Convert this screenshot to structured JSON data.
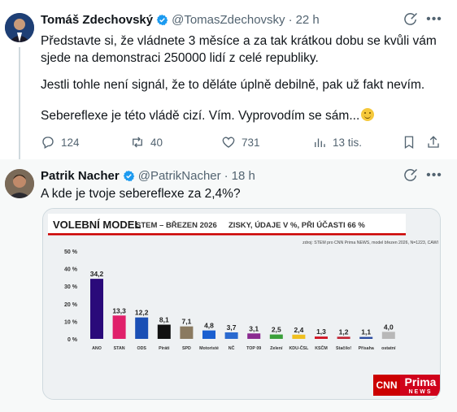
{
  "tweet1": {
    "author": "Tomáš Zdechovský",
    "handle": "@TomasZdechovsky",
    "separator": "·",
    "time": "22 h",
    "paragraphs": [
      "Představte si, že vládnete 3 měsíce a za tak krátkou dobu se kvůli vám sjede na demonstraci 250000 lidí z celé republiky.",
      "Jestli tohle není signál, že to děláte úplně debilně, pak už fakt nevím.",
      "Sebereflexe je této vládě cizí. Vím. Vyprovodím se sám..."
    ],
    "emoji": "slightly-smiling-face",
    "actions": {
      "replies": "124",
      "reposts": "40",
      "likes": "731",
      "views": "13 tis."
    }
  },
  "tweet2": {
    "author": "Patrik Nacher",
    "handle": "@PatrikNacher",
    "separator": "·",
    "time": "18 h",
    "text": "A kde je tvoje sebereflexe za 2,4%?"
  },
  "colors": {
    "verified_badge": "#1d9bf0",
    "muted_text": "#536471",
    "chart_header_border": "#cc0000"
  },
  "icons": [
    "grok-icon",
    "more-icon",
    "reply-icon",
    "repost-icon",
    "like-icon",
    "views-icon",
    "bookmark-icon",
    "share-icon",
    "verified-badge-icon"
  ],
  "chart_data": {
    "type": "bar",
    "title": "VOLEBNÍ MODEL",
    "subtitle": "STEM – BŘEZEN 2026",
    "subtitle2": "ZISKY, ÚDAJE V %, PŘI ÚČASTI 66 %",
    "source": "zdroj: STEM pro CNN Prima NEWS, model březen 2026, N=1223, CAWI",
    "categories": [
      "ANO",
      "STAN",
      "ODS",
      "Piráti",
      "SPD",
      "Motoristé",
      "NČ",
      "TOP 09",
      "Zelení",
      "KDU-ČSL",
      "KSČM",
      "Stačilo!",
      "Přísaha",
      "ostatní"
    ],
    "values": [
      34.2,
      13.3,
      12.2,
      8.1,
      7.1,
      4.8,
      3.7,
      3.1,
      2.5,
      2.4,
      1.3,
      1.2,
      1.1,
      4.0
    ],
    "value_labels": [
      "34,2",
      "13,3",
      "12,2",
      "8,1",
      "7,1",
      "4,8",
      "3,7",
      "3,1",
      "2,5",
      "2,4",
      "1,3",
      "1,2",
      "1,1",
      "4,0"
    ],
    "bar_colors": [
      "#2a0a7a",
      "#e0206a",
      "#1a4fb5",
      "#111111",
      "#8a7a60",
      "#1a5fd0",
      "#2a6ad0",
      "#8a2a90",
      "#3aa03a",
      "#f0c020",
      "#d01020",
      "#c02030",
      "#2a4aa0",
      "#b8b8b8"
    ],
    "ylim": [
      0,
      50
    ],
    "yticks": [
      0,
      10,
      20,
      30,
      40,
      50
    ],
    "ytick_labels": [
      "0 %",
      "10 %",
      "20 %",
      "30 %",
      "40 %",
      "50 %"
    ],
    "grid": false,
    "logo_cnn": "CNN",
    "logo_prima": "Prima",
    "logo_news": "NEWS"
  }
}
